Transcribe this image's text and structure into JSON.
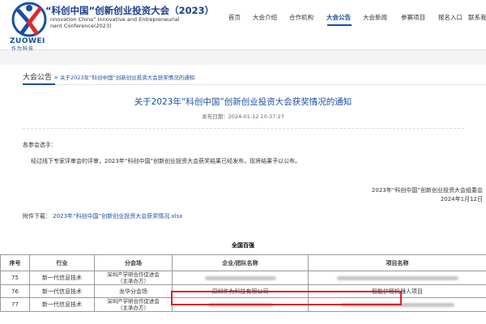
{
  "header": {
    "title": "“科创中国”创新创业投资大会（2023）",
    "subtitle_line1": "nnovation China” Innovative and Entrepreneurial",
    "subtitle_line2": "nent Conference(2023)",
    "logo_text": "ZUOWEI",
    "logo_text_cn": "作为科技",
    "accent_color": "#1a4fa3"
  },
  "nav": {
    "items": [
      "首页",
      "大会介绍",
      "合作机构",
      "大会公告",
      "大会新闻",
      "参赛项目",
      "报名入口",
      "联系我们"
    ],
    "active": "大会公告"
  },
  "breadcrumb": {
    "home": "大会公告",
    "separator": "»",
    "current": "关于2023年“科创中国”创新创业投资大会获奖情况的通知"
  },
  "notice": {
    "title": "关于2023年“科创中国”创新创业投资大会获奖情况的通知",
    "date_label": "发布日期：2024-01-12 10:37:27",
    "greeting": "各参会选手：",
    "body": "经过线下专家评审会的评审，2023年“科创中国”创新创业投资大会获奖结果已经发布，现将结果予以公布。",
    "sign_org": "2023年“科创中国”创新创业投资大会组委会",
    "sign_date": "2024年1月12日",
    "attachment_label": "附件下载：",
    "attachment_name": "2023年“科创中国”创新创业投资大会获奖情况.xlsx"
  },
  "table": {
    "title": "全国百强",
    "headers": [
      "序号",
      "行业",
      "分会场",
      "企业/团队名称",
      "项目名称"
    ],
    "rows": [
      {
        "no": "75",
        "industry": "新一代信息技术",
        "venue_line1": "深圳产学研合作促进会",
        "venue_line2": "（主承办方）",
        "company": "",
        "project": ""
      },
      {
        "no": "76",
        "industry": "新一代信息技术",
        "venue_line1": "龙华分会场",
        "venue_line2": "",
        "company": "深圳作为科技有限公司",
        "project": "智能护理机器人项目"
      },
      {
        "no": "77",
        "industry": "新一代信息技术",
        "venue_line1": "深圳产学研合作促进会",
        "venue_line2": "（主承办方）",
        "company": "",
        "project": ""
      }
    ],
    "highlight_color": "#e02020"
  }
}
